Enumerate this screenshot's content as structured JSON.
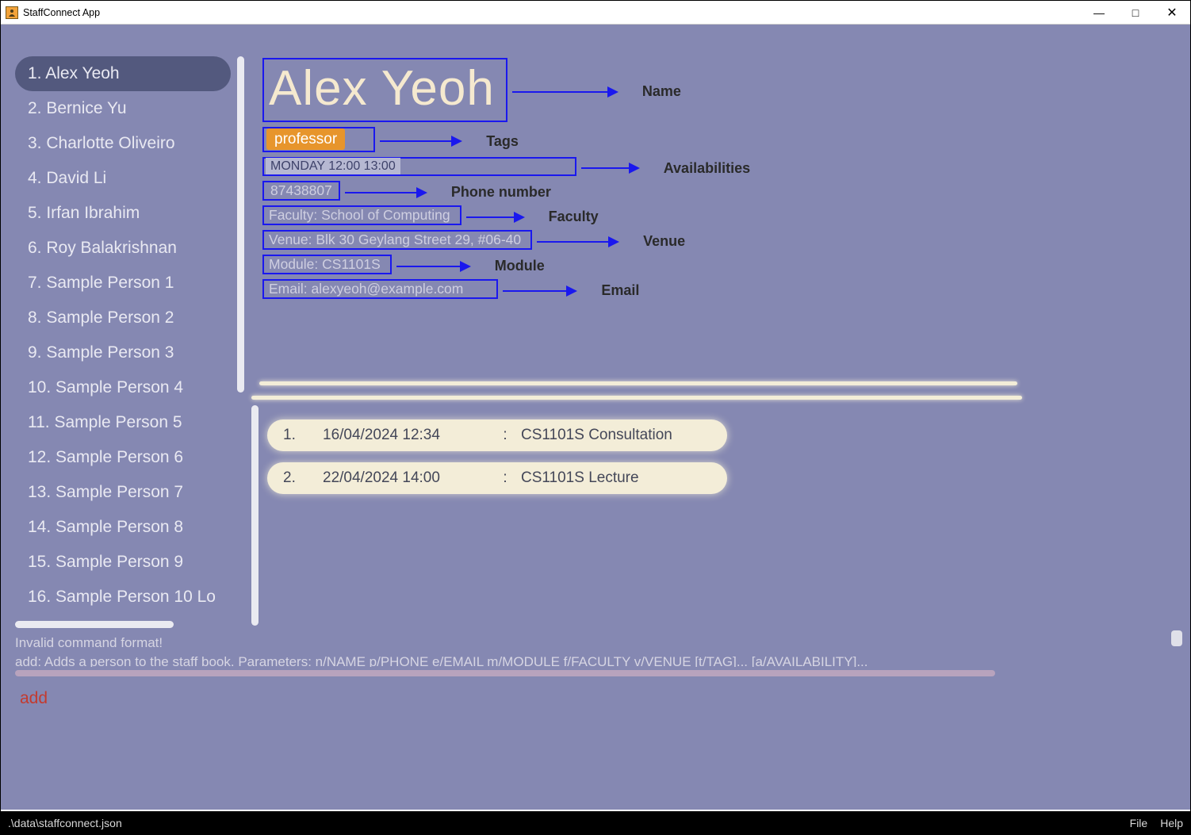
{
  "window": {
    "title": "StaffConnect App"
  },
  "sidebar": {
    "items": [
      {
        "index": "1.",
        "name": "Alex Yeoh",
        "selected": true
      },
      {
        "index": "2.",
        "name": "Bernice Yu"
      },
      {
        "index": "3.",
        "name": "Charlotte Oliveiro"
      },
      {
        "index": "4.",
        "name": "David Li"
      },
      {
        "index": "5.",
        "name": "Irfan Ibrahim"
      },
      {
        "index": "6.",
        "name": "Roy Balakrishnan"
      },
      {
        "index": "7.",
        "name": "Sample Person 1"
      },
      {
        "index": "8.",
        "name": "Sample Person 2"
      },
      {
        "index": "9.",
        "name": "Sample Person 3"
      },
      {
        "index": "10.",
        "name": "Sample Person 4"
      },
      {
        "index": "11.",
        "name": "Sample Person 5"
      },
      {
        "index": "12.",
        "name": "Sample Person 6"
      },
      {
        "index": "13.",
        "name": "Sample Person 7"
      },
      {
        "index": "14.",
        "name": "Sample Person 8"
      },
      {
        "index": "15.",
        "name": "Sample Person 9"
      },
      {
        "index": "16.",
        "name": "Sample Person 10 Lo"
      }
    ]
  },
  "detail": {
    "name": "Alex Yeoh",
    "tag": "professor",
    "availability": "MONDAY 12:00 13:00",
    "phone": "87438807",
    "faculty": "Faculty:  School of Computing",
    "venue": "Venue:  Blk 30 Geylang Street 29, #06-40",
    "module": "Module:  CS1101S",
    "email": "Email:  alexyeoh@example.com"
  },
  "annotations": {
    "name": "Name",
    "tags": "Tags",
    "availabilities": "Availabilities",
    "phone": "Phone number",
    "faculty": "Faculty",
    "venue": "Venue",
    "module": "Module",
    "email": "Email"
  },
  "events": [
    {
      "index": "1.",
      "datetime": "16/04/2024 12:34",
      "sep": ":",
      "desc": "CS1101S Consultation"
    },
    {
      "index": "2.",
      "datetime": "22/04/2024 14:00",
      "sep": ":",
      "desc": "CS1101S Lecture"
    }
  ],
  "message": {
    "line1": "Invalid command format!",
    "line2": "add: Adds a person to the staff book. Parameters: n/NAME p/PHONE e/EMAIL m/MODULE f/FACULTY v/VENUE [t/TAG]... [a/AVAILABILITY]..."
  },
  "command": {
    "text": "add"
  },
  "statusbar": {
    "path": ".\\data\\staffconnect.json",
    "file": "File",
    "help": "Help"
  }
}
